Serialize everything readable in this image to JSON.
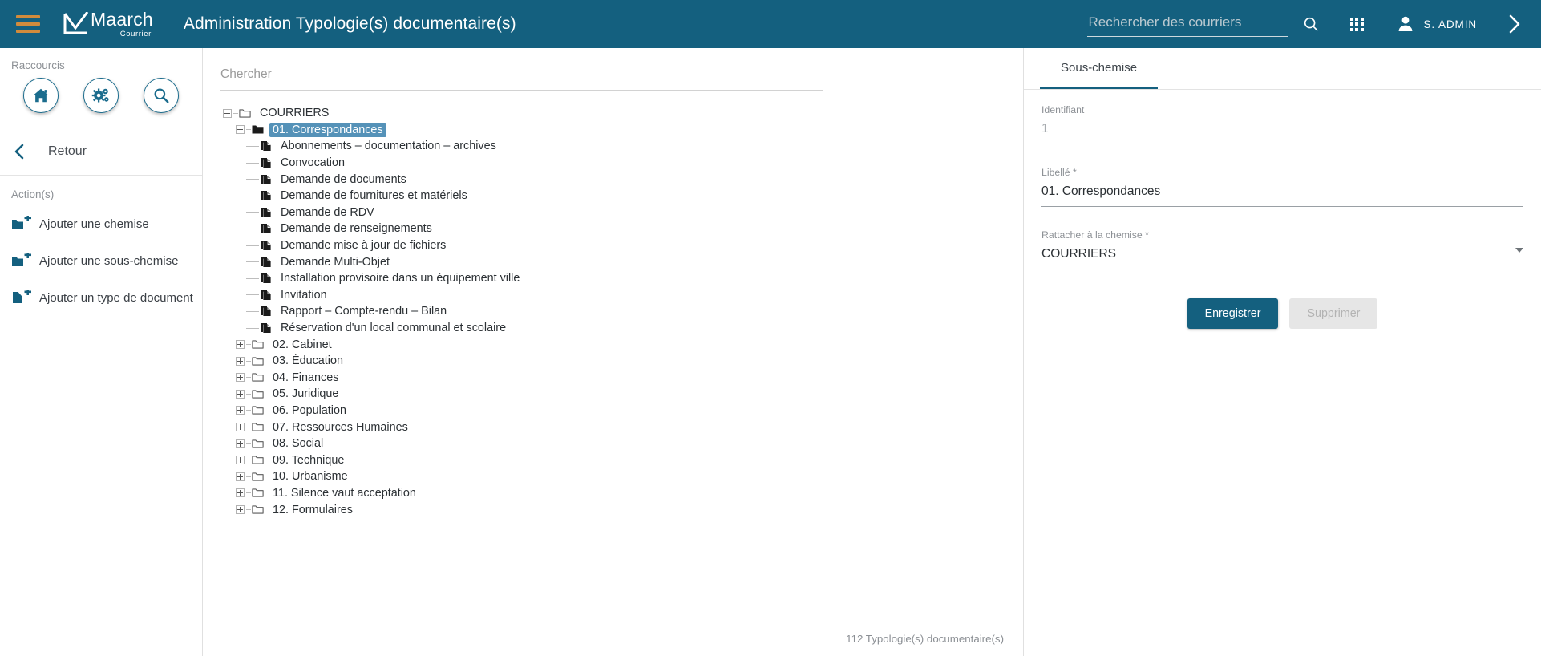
{
  "header": {
    "menu_icon": "hamburger-icon",
    "logo_name": "Maarch",
    "logo_sub": "Courrier",
    "title": "Administration Typologie(s) documentaire(s)",
    "search_placeholder": "Rechercher des courriers",
    "search_value": "",
    "search_icon": "search-icon",
    "apps_icon": "grid-apps-icon",
    "user_icon": "user-avatar-icon",
    "user_name": "S. ADMIN",
    "expand_icon": "chevron-right-icon",
    "bg_color": "#14607f",
    "accent_color": "#d18b3c"
  },
  "sidebar": {
    "shortcuts_label": "Raccourcis",
    "shortcuts": [
      {
        "name": "home-shortcut",
        "icon": "home-icon"
      },
      {
        "name": "settings-shortcut",
        "icon": "gears-icon"
      },
      {
        "name": "search-shortcut",
        "icon": "search-icon"
      }
    ],
    "back_label": "Retour",
    "back_icon": "chevron-left-icon",
    "actions_label": "Action(s)",
    "actions": [
      {
        "label": "Ajouter une chemise",
        "icon": "folder-plus-icon"
      },
      {
        "label": "Ajouter une sous-chemise",
        "icon": "folder-plus-icon"
      },
      {
        "label": "Ajouter un type de document",
        "icon": "file-plus-icon"
      }
    ]
  },
  "center": {
    "search_placeholder": "Chercher",
    "search_value": "",
    "count_text": "112 Typologie(s) documentaire(s)",
    "tree": [
      {
        "label": "COURRIERS",
        "type": "folder",
        "level": 0,
        "toggle": "minus",
        "selected": false
      },
      {
        "label": "01. Correspondances",
        "type": "folder-open",
        "level": 1,
        "toggle": "minus",
        "selected": true
      },
      {
        "label": "Abonnements – documentation – archives",
        "type": "doc",
        "level": 2,
        "toggle": "none",
        "selected": false
      },
      {
        "label": "Convocation",
        "type": "doc",
        "level": 2,
        "toggle": "none",
        "selected": false
      },
      {
        "label": "Demande de documents",
        "type": "doc",
        "level": 2,
        "toggle": "none",
        "selected": false
      },
      {
        "label": "Demande de fournitures et matériels",
        "type": "doc",
        "level": 2,
        "toggle": "none",
        "selected": false
      },
      {
        "label": "Demande de RDV",
        "type": "doc",
        "level": 2,
        "toggle": "none",
        "selected": false
      },
      {
        "label": "Demande de renseignements",
        "type": "doc",
        "level": 2,
        "toggle": "none",
        "selected": false
      },
      {
        "label": "Demande mise à jour de fichiers",
        "type": "doc",
        "level": 2,
        "toggle": "none",
        "selected": false
      },
      {
        "label": "Demande Multi-Objet",
        "type": "doc",
        "level": 2,
        "toggle": "none",
        "selected": false
      },
      {
        "label": "Installation provisoire dans un équipement ville",
        "type": "doc",
        "level": 2,
        "toggle": "none",
        "selected": false
      },
      {
        "label": "Invitation",
        "type": "doc",
        "level": 2,
        "toggle": "none",
        "selected": false
      },
      {
        "label": "Rapport – Compte-rendu – Bilan",
        "type": "doc",
        "level": 2,
        "toggle": "none",
        "selected": false
      },
      {
        "label": "Réservation d'un local communal et scolaire",
        "type": "doc",
        "level": 2,
        "toggle": "none",
        "selected": false,
        "last": true
      },
      {
        "label": "02. Cabinet",
        "type": "folder",
        "level": 1,
        "toggle": "plus",
        "selected": false
      },
      {
        "label": "03. Éducation",
        "type": "folder",
        "level": 1,
        "toggle": "plus",
        "selected": false
      },
      {
        "label": "04. Finances",
        "type": "folder",
        "level": 1,
        "toggle": "plus",
        "selected": false
      },
      {
        "label": "05. Juridique",
        "type": "folder",
        "level": 1,
        "toggle": "plus",
        "selected": false
      },
      {
        "label": "06. Population",
        "type": "folder",
        "level": 1,
        "toggle": "plus",
        "selected": false
      },
      {
        "label": "07. Ressources Humaines",
        "type": "folder",
        "level": 1,
        "toggle": "plus",
        "selected": false
      },
      {
        "label": "08. Social",
        "type": "folder",
        "level": 1,
        "toggle": "plus",
        "selected": false
      },
      {
        "label": "09. Technique",
        "type": "folder",
        "level": 1,
        "toggle": "plus",
        "selected": false
      },
      {
        "label": "10. Urbanisme",
        "type": "folder",
        "level": 1,
        "toggle": "plus",
        "selected": false
      },
      {
        "label": "11. Silence vaut acceptation",
        "type": "folder",
        "level": 1,
        "toggle": "plus",
        "selected": false
      },
      {
        "label": "12. Formulaires",
        "type": "folder",
        "level": 1,
        "toggle": "plus",
        "selected": false,
        "last": true
      }
    ]
  },
  "right": {
    "tabs": [
      {
        "label": "Sous-chemise",
        "active": true
      }
    ],
    "fields": [
      {
        "name": "identifiant",
        "label": "Identifiant",
        "value": "1",
        "readonly": true
      },
      {
        "name": "libelle",
        "label": "Libellé *",
        "value": "01. Correspondances",
        "readonly": false
      },
      {
        "name": "rattacher-chemise",
        "label": "Rattacher à la chemise *",
        "value": "COURRIERS",
        "readonly": false,
        "select": true
      }
    ],
    "save_label": "Enregistrer",
    "delete_label": "Supprimer",
    "primary_color": "#14607f"
  }
}
